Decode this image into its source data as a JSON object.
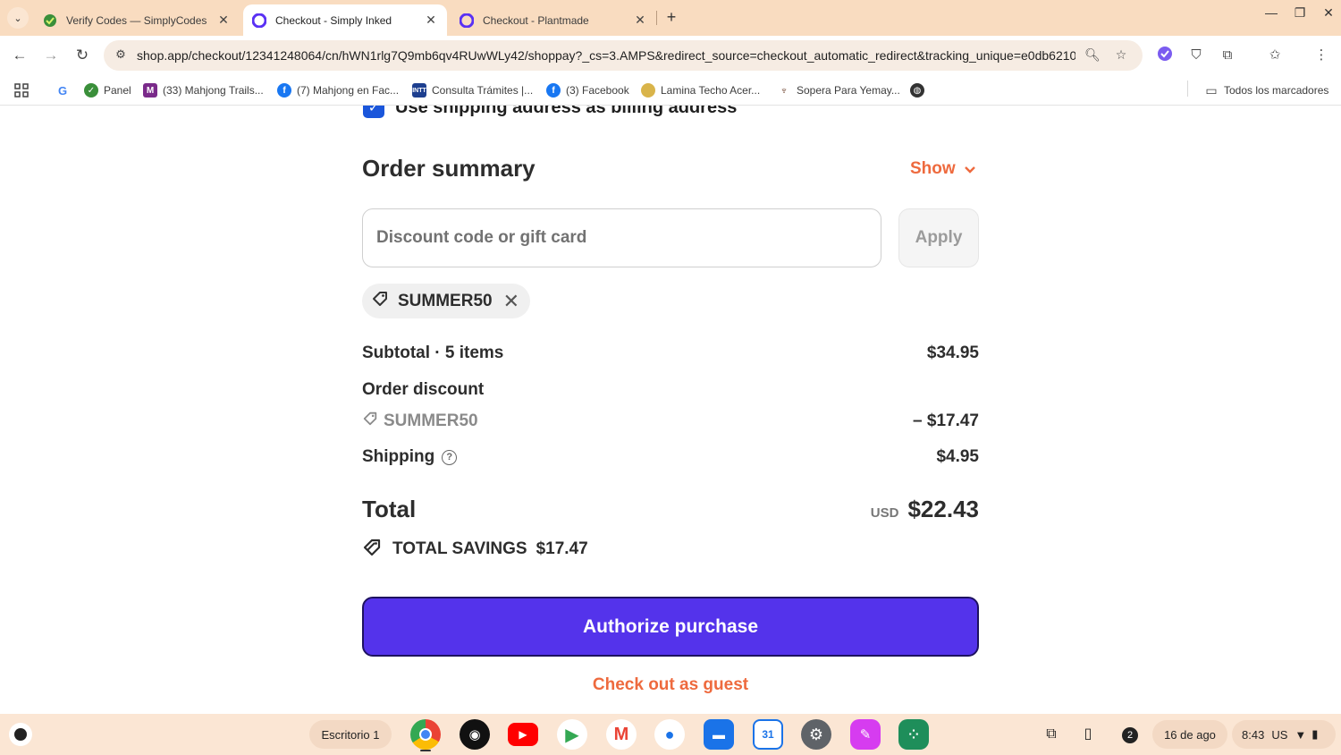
{
  "browser": {
    "tabs": [
      {
        "title": "Verify Codes — SimplyCodes",
        "active": false
      },
      {
        "title": "Checkout - Simply Inked",
        "active": true
      },
      {
        "title": "Checkout - Plantmade",
        "active": false
      }
    ],
    "url": "shop.app/checkout/12341248064/cn/hWN1rlg7Q9mb6qv4RUwWLy42/shoppay?_cs=3.AMPS&redirect_source=checkout_automatic_redirect&tracking_unique=e0db6210-e...",
    "bookmarks": [
      {
        "label": "",
        "icon": "google-icon"
      },
      {
        "label": "Panel",
        "icon": "simplycodes-icon"
      },
      {
        "label": "(33) Mahjong Trails...",
        "icon": "mahjong-icon"
      },
      {
        "label": "(7) Mahjong en Fac...",
        "icon": "facebook-icon"
      },
      {
        "label": "Consulta Trámites |...",
        "icon": "intt-icon"
      },
      {
        "label": "(3) Facebook",
        "icon": "facebook-icon"
      },
      {
        "label": "Lamina Techo Acer...",
        "icon": "lamina-icon"
      },
      {
        "label": "Sopera Para Yemay...",
        "icon": "sopera-icon"
      },
      {
        "label": "",
        "icon": "globe-icon"
      }
    ],
    "all_bookmarks": "Todos los marcadores"
  },
  "checkout": {
    "billing_label": "Use shipping address as billing address",
    "order_summary": "Order summary",
    "show_label": "Show",
    "discount_placeholder": "Discount code or gift card",
    "apply_label": "Apply",
    "applied_code": "SUMMER50",
    "subtotal_label": "Subtotal · 5 items",
    "subtotal_value": "$34.95",
    "order_discount_label": "Order discount",
    "discount_code": "SUMMER50",
    "discount_value": "– $17.47",
    "shipping_label": "Shipping",
    "shipping_value": "$4.95",
    "total_label": "Total",
    "currency": "USD",
    "total_value": "$22.43",
    "savings_label": "TOTAL SAVINGS",
    "savings_value": "$17.47",
    "authorize_label": "Authorize purchase",
    "guest_label": "Check out as guest"
  },
  "shelf": {
    "desk_label": "Escritorio 1",
    "notification_count": "2",
    "date": "16 de ago",
    "time": "8:43",
    "locale": "US"
  },
  "colors": {
    "accent_orange": "#ee6a3e",
    "primary_purple": "#5433eb",
    "tabbar": "#f9dcc0"
  }
}
